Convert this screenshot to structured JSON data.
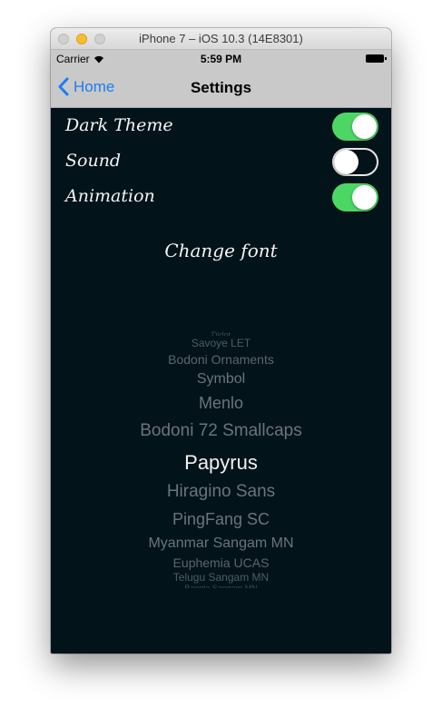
{
  "window": {
    "title": "iPhone 7 – iOS 10.3 (14E8301)"
  },
  "status_bar": {
    "carrier": "Carrier",
    "time": "5:59 PM",
    "icons": [
      "wifi-icon",
      "battery-icon"
    ]
  },
  "nav": {
    "back_label": "Home",
    "title": "Settings"
  },
  "settings": {
    "rows": [
      {
        "label": "Dark Theme",
        "on": true
      },
      {
        "label": "Sound",
        "on": false
      },
      {
        "label": "Animation",
        "on": true
      }
    ]
  },
  "change_font_label": "Change font",
  "font_picker": {
    "items": [
      "Didot",
      "Savoye LET",
      "Bodoni Ornaments",
      "Symbol",
      "Menlo",
      "Bodoni 72 Smallcaps",
      "Papyrus",
      "Hiragino Sans",
      "PingFang SC",
      "Myanmar Sangam MN",
      "Euphemia UCAS",
      "Telugu Sangam MN",
      "Bangla Sangam MN"
    ],
    "selected": "Papyrus"
  },
  "colors": {
    "accent": "#1f7cf4",
    "switch_on": "#4cd764",
    "background": "#02131a",
    "bar": "#c9c9c9"
  }
}
